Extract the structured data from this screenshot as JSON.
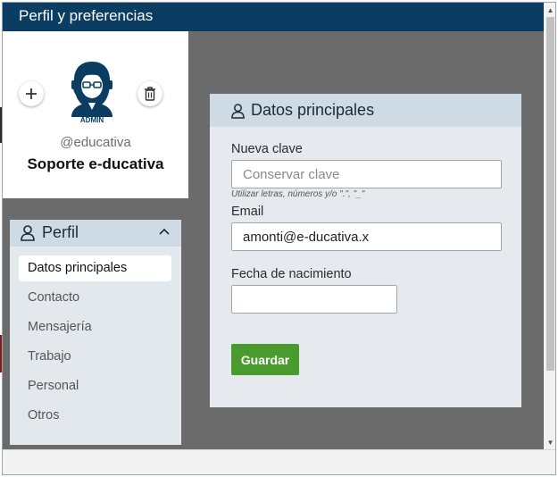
{
  "window": {
    "title": "Perfil y preferencias"
  },
  "colors": {
    "titlebar": "#0b3d63",
    "overlay": "#6b6b6b",
    "panel_header": "#cfdbe4",
    "panel_body": "#e6eaee",
    "save_button": "#4a9b2e"
  },
  "profile": {
    "avatar_badge": "ADMIN",
    "handle": "@educativa",
    "name": "Soporte e-ducativa",
    "add_icon": "plus-icon",
    "delete_icon": "trash-icon"
  },
  "nav": {
    "header": "Perfil",
    "header_icon": "user-icon",
    "collapse_icon": "chevron-up-icon",
    "items": [
      {
        "label": "Datos principales",
        "active": true
      },
      {
        "label": "Contacto",
        "active": false
      },
      {
        "label": "Mensajería",
        "active": false
      },
      {
        "label": "Trabajo",
        "active": false
      },
      {
        "label": "Personal",
        "active": false
      },
      {
        "label": "Otros",
        "active": false
      }
    ]
  },
  "form": {
    "title": "Datos principales",
    "password": {
      "label": "Nueva clave",
      "placeholder": "Conservar clave",
      "value": "",
      "hint": "Utilizar letras, números y/o \".\", \"_\""
    },
    "email": {
      "label": "Email",
      "value": "amonti@e-ducativa.x"
    },
    "birthdate": {
      "label": "Fecha de nacimiento",
      "value": ""
    },
    "save_label": "Guardar"
  }
}
